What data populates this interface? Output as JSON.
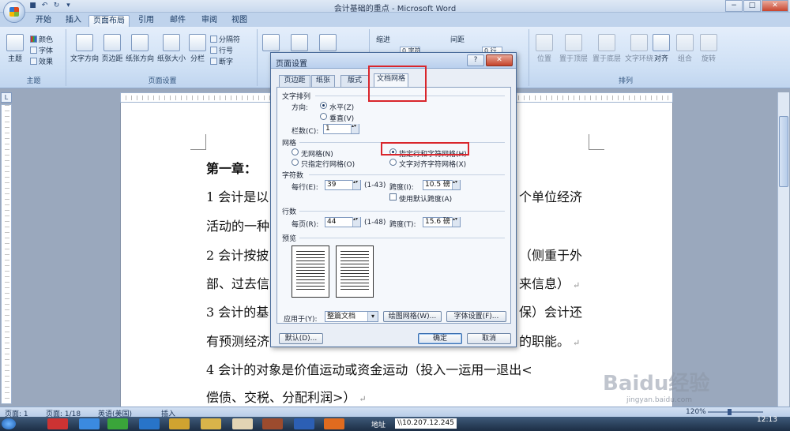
{
  "window": {
    "title": "会计基础的重点 - Microsoft Word",
    "minimize": "−",
    "maximize": "□",
    "close": "✕"
  },
  "ribbon_tabs": [
    "开始",
    "插入",
    "页面布局",
    "引用",
    "邮件",
    "审阅",
    "视图"
  ],
  "ribbon": {
    "theme_group": {
      "label": "主题",
      "theme": "主题",
      "colors": "颜色",
      "fonts": "字体",
      "effects": "效果"
    },
    "page_setup_group": {
      "label": "页面设置",
      "text_direction": "文字方向",
      "margins": "页边距",
      "orientation": "纸张方向",
      "size": "纸张大小",
      "columns": "分栏",
      "breaks": "分隔符",
      "line_numbers": "行号",
      "hyphenation": "断字"
    },
    "indent_label": "缩进",
    "indent_left_value": "0 字符",
    "spacing_label": "间距",
    "spacing_before_value": "0 行",
    "arrange_group": {
      "label": "排列",
      "position": "位置",
      "bring_front": "置于顶层",
      "send_back": "置于底层",
      "text_wrap": "文字环绕",
      "align": "对齐",
      "group": "组合",
      "rotate": "旋转"
    }
  },
  "document": {
    "heading": "第一章：",
    "lines": [
      "1 会计是以",
      "个单位经济",
      "活动的一种",
      "2 会计按披",
      "（侧重于外",
      "部、过去信",
      "来信息）",
      "3 会计的基",
      "保）会计还",
      "有预测经济",
      "的职能。",
      "4 会计的对象是价值运动或资金运动（投入一运用一退出<",
      "偿债、交税、分配利润>）"
    ]
  },
  "dialog": {
    "title": "页面设置",
    "help": "?",
    "close": "✕",
    "tabs": [
      "页边距",
      "纸张",
      "版式",
      "文档网格"
    ],
    "text_arrangement_label": "文字排列",
    "direction_label": "方向:",
    "direction_horizontal": "水平(Z)",
    "direction_vertical": "垂直(V)",
    "columns_label": "栏数(C):",
    "columns_value": "1",
    "grid_label": "网格",
    "grid_options": [
      "无网格(N)",
      "只指定行网格(O)",
      "指定行和字符网格(H)",
      "文字对齐字符网格(X)"
    ],
    "characters_label": "字符数",
    "per_line_label": "每行(E):",
    "per_line_value": "39",
    "per_line_range": "(1-43)",
    "pitch_label": "跨度(I):",
    "char_pitch_value": "10.5 磅",
    "default_pitch": "使用默认跨度(A)",
    "lines_label": "行数",
    "per_page_label": "每页(R):",
    "per_page_value": "44",
    "per_page_range": "(1-48)",
    "line_pitch_label": "跨度(T):",
    "line_pitch_value": "15.6 磅",
    "preview_label": "预览",
    "apply_to_label": "应用于(Y):",
    "apply_to_value": "整篇文档",
    "draw_grid_button": "绘图网格(W)...",
    "font_settings_button": "字体设置(F)...",
    "default_button": "默认(D)...",
    "ok_button": "确定",
    "cancel_button": "取消"
  },
  "status_bar": {
    "page": "页面: 1",
    "page_count": "页面: 1/18",
    "language": "英语(美国)",
    "mode": "插入",
    "zoom": "120%",
    "zoom_level": 0.35
  },
  "taskbar": {
    "address_label": "地址",
    "address_value": "\\\\10.207.12.245",
    "clock": "12:13"
  },
  "watermark": {
    "brand": "Baidu经验",
    "url": "jingyan.baidu.com"
  },
  "colors": {
    "highlight": "#d9262c",
    "ribbon": "#cddff4"
  }
}
